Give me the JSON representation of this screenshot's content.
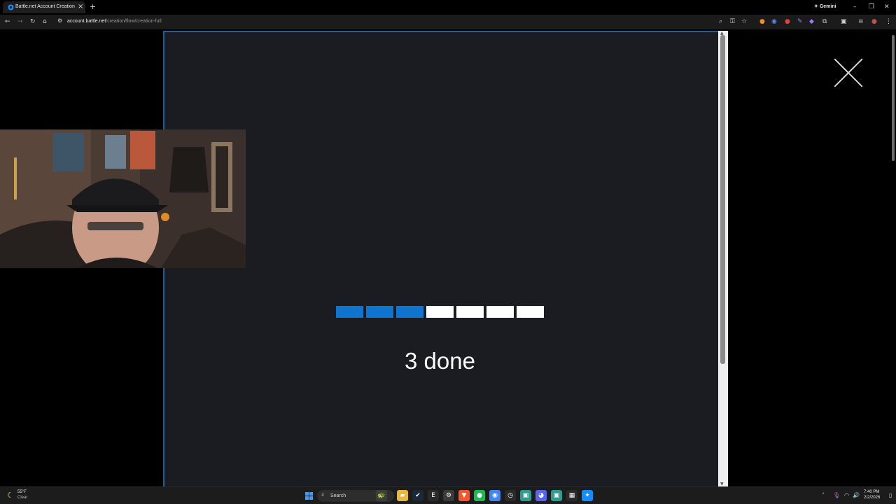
{
  "browser": {
    "tab_title": "Battle.net Account Creation",
    "tab_close": "×",
    "new_tab": "+",
    "gemini_label": "Gemini",
    "url_domain": "account.battle.net",
    "url_path": "/creation/flow/creation-full"
  },
  "page": {
    "progress": {
      "completed": 3,
      "total": 7,
      "done_color": "#0f74d0",
      "todo_color": "#ffffff"
    },
    "status_text": "3 done",
    "modal_background": "#1b1c21"
  },
  "taskbar": {
    "weather_temp": "55°F",
    "weather_condition": "Clear",
    "search_label": "Search",
    "clock_time": "7:40 PM",
    "clock_date": "2/2/2026",
    "pinned_apps": [
      "widgets-icon",
      "file-explorer-icon",
      "steam-icon",
      "epic-games-icon",
      "settings-icon",
      "brave-icon",
      "spotify-icon",
      "chrome-icon",
      "clock-icon",
      "app-icon",
      "discord-icon",
      "app-icon",
      "calendar-icon",
      "battlenet-icon"
    ]
  }
}
